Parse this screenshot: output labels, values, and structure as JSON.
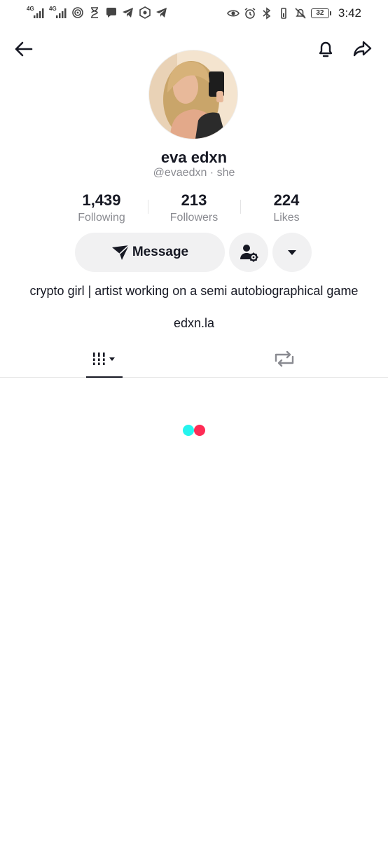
{
  "status_bar": {
    "net1": "4G",
    "net2": "4G",
    "battery": "32",
    "time": "3:42"
  },
  "profile": {
    "display_name": "eva edxn",
    "handle": "@evaedxn",
    "pronouns": "she",
    "separator": " · "
  },
  "stats": [
    {
      "value": "1,439",
      "label": "Following"
    },
    {
      "value": "213",
      "label": "Followers"
    },
    {
      "value": "224",
      "label": "Likes"
    }
  ],
  "actions": {
    "message_label": "Message"
  },
  "bio": {
    "text": "crypto girl | artist working on a semi autobiographical game",
    "link": "edxn.la"
  },
  "colors": {
    "loader_cyan": "#25f4ee",
    "loader_red": "#fe2c55",
    "button_bg": "#f1f1f2",
    "muted_text": "#8a8b91"
  },
  "icons": {
    "back": "arrow-left-icon",
    "notifications": "bell-icon",
    "share": "share-arrow-icon",
    "message": "paper-plane-icon",
    "add_friend": "person-gear-icon",
    "more": "caret-down-icon",
    "videos_tab": "grid-bars-icon",
    "reposts_tab": "repost-icon"
  }
}
